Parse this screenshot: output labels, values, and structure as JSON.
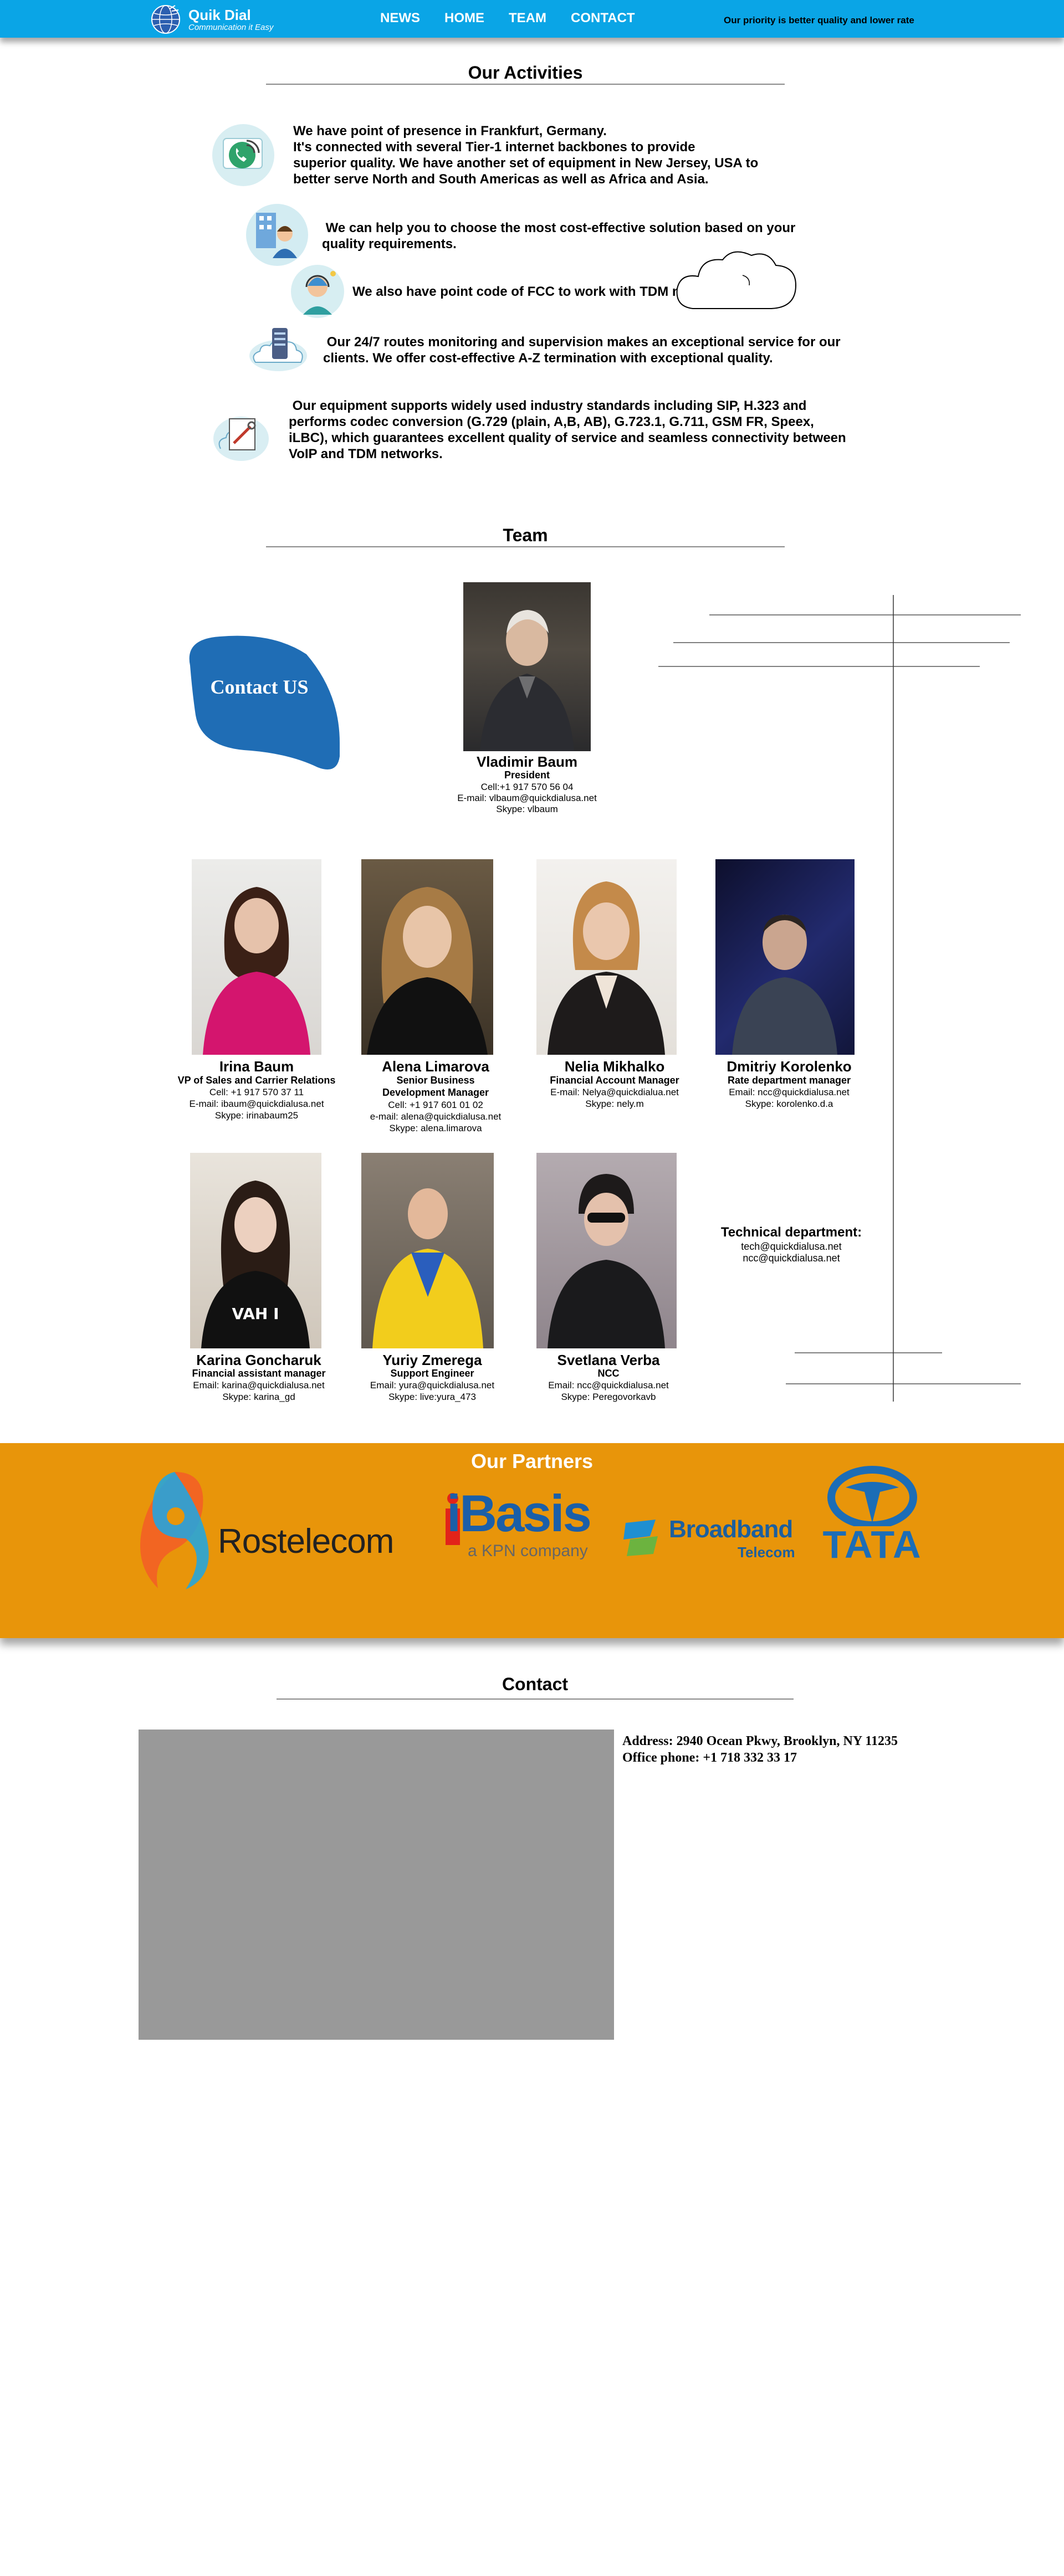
{
  "header": {
    "brand_name": "Quik Dial",
    "brand_tagline": "Communication it Easy",
    "nav": [
      "NEWS",
      "HOME",
      "TEAM",
      "CONTACT"
    ],
    "tagline": "Our priority is better quality and lower rate"
  },
  "activities": {
    "title": "Our Activities",
    "items": [
      {
        "icon": "phone-wifi-icon",
        "lines": [
          "We have point of presence in Frankfurt, Germany.",
          "It's connected with several Tier-1 internet backbones to provide",
          "superior quality. We have another set of equipment in New Jersey, USA to",
          "better serve North and South Americas as well as Africa and Asia."
        ]
      },
      {
        "icon": "consultant-icon",
        "lines": [
          " We can help you to choose the most cost-effective solution based on your",
          "quality requirements."
        ]
      },
      {
        "icon": "operator-icon",
        "lines": [
          "We also have point code of FCC to work with TDM networks."
        ]
      },
      {
        "icon": "cloud-server-icon",
        "lines": [
          " Our 24/7 routes monitoring and supervision makes an exceptional service for our",
          "clients. We offer cost-effective A-Z termination with exceptional quality."
        ]
      },
      {
        "icon": "tools-icon",
        "lines": [
          " Our equipment supports widely used industry standards including SIP, H.323 and",
          "performs codec conversion (G.729 (plain, A,B, AB), G.723.1, G.711, GSM FR, Speex,",
          "iLBC), which guarantees excellent quality of service and seamless connectivity between",
          "VoIP and TDM networks."
        ]
      }
    ]
  },
  "team": {
    "title": "Team",
    "contact_button": "Contact US",
    "members": [
      {
        "name": "Vladimir Baum",
        "role": [
          "President"
        ],
        "lines": [
          "Cell:+1 917 570 56 04",
          "E-mail: vlbaum@quickdialusa.net",
          "Skype: vlbaum"
        ]
      },
      {
        "name": "Irina Baum",
        "role": [
          "VP of Sales and Carrier Relations"
        ],
        "lines": [
          "Cell: +1 917 570 37 11",
          "E-mail: ibaum@quickdialusa.net",
          "Skype: irinabaum25"
        ]
      },
      {
        "name": "Alena Limarova",
        "role": [
          "Senior Business",
          "Development Manager"
        ],
        "lines": [
          "Cell: +1 917 601 01 02",
          "e-mail: alena@quickdialusa.net",
          "Skype: alena.limarova"
        ]
      },
      {
        "name": "Nelia Mikhalko",
        "role": [
          "Financial Account Manager"
        ],
        "lines": [
          "E-mail: Nelya@quickdialua.net",
          "Skype: nely.m"
        ]
      },
      {
        "name": "Dmitriy Korolenko",
        "role": [
          "Rate department manager"
        ],
        "lines": [
          "Email: ncc@quickdialusa.net",
          "Skype: korolenko.d.a"
        ]
      },
      {
        "name": "Karina Goncharuk",
        "role": [
          "Financial assistant manager"
        ],
        "lines": [
          "Email: karina@quickdialusa.net",
          "Skype: karina_gd"
        ]
      },
      {
        "name": "Yuriy Zmerega",
        "role": [
          "Support Engineer"
        ],
        "lines": [
          "Email: yura@quickdialusa.net",
          "Skype: live:yura_473"
        ]
      },
      {
        "name": "Svetlana Verba",
        "role": [
          "NCC"
        ],
        "lines": [
          "Email: ncc@quickdialusa.net",
          "Skype: Peregovorkavb"
        ]
      }
    ],
    "tech": {
      "title": "Technical department:",
      "lines": [
        "tech@quickdialusa.net",
        "ncc@quickdialusa.net"
      ]
    }
  },
  "partners": {
    "title": "Our Partners",
    "logos": [
      {
        "icon": "rostelecom-logo",
        "text": "Rostelecom"
      },
      {
        "icon": "ibasis-logo",
        "text": "iBasis",
        "subtext": "a KPN company"
      },
      {
        "icon": "broadband-telecom-logo",
        "text": "Broadband",
        "subtext": "Telecom"
      },
      {
        "icon": "tata-logo",
        "text": "TATA"
      }
    ]
  },
  "contact": {
    "title": "Contact",
    "address": "Address: 2940 Ocean Pkwy, Brooklyn, NY 11235",
    "phone": "Office phone: +1 718 332 33 17"
  },
  "colors": {
    "header_blue": "#0aa5e6",
    "partners_orange": "#e8950a",
    "contact_button_blue": "#1f6db5",
    "map_gray": "#999999"
  }
}
